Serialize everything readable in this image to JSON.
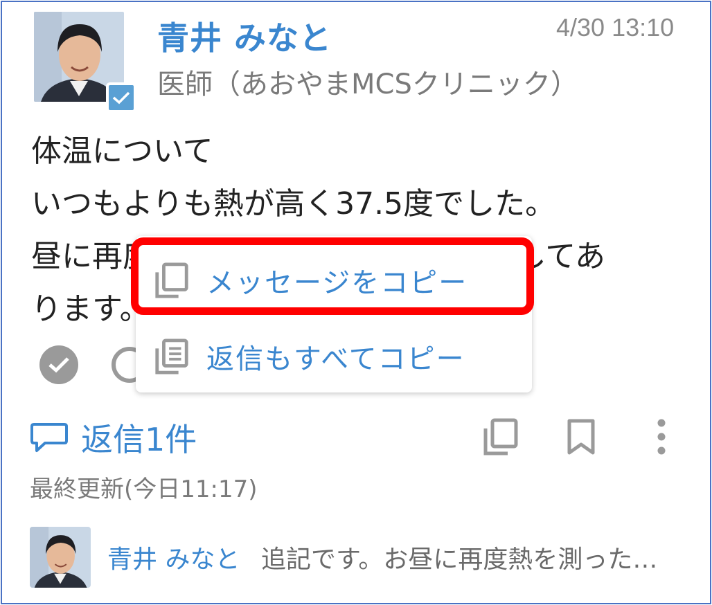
{
  "post": {
    "author_name": "青井 みなと",
    "author_role": "医師（あおやまMCSクリニック）",
    "timestamp": "4/30 13:10",
    "body_lines": [
      "体温について",
      "いつもよりも熱が高く37.5度でした。",
      "昼に再度はかってもらうように依頼してあ",
      "ります。"
    ]
  },
  "context_menu": {
    "copy_message_label": "メッセージをコピー",
    "copy_all_label": "返信もすべてコピー"
  },
  "footer": {
    "reply_count_label": "返信1件",
    "last_updated": "最終更新(今日11:17)"
  },
  "latest_reply": {
    "author_name": "青井 みなと",
    "preview": "追記です。お昼に再度熱を測った…"
  },
  "colors": {
    "accent": "#3a86cf",
    "highlight": "#ff0000",
    "frame": "#4a72c4",
    "badge": "#5aa0d4",
    "icon_gray": "#9a9a9a"
  },
  "icons": {
    "verified": "check-badge-icon",
    "reaction_check": "check-circle-icon",
    "reaction_emoji": "smiley-icon",
    "copy": "copy-icon",
    "copy_all": "copy-list-icon",
    "reply": "speech-bubble-icon",
    "bookmark": "bookmark-icon",
    "more": "more-vertical-icon"
  }
}
